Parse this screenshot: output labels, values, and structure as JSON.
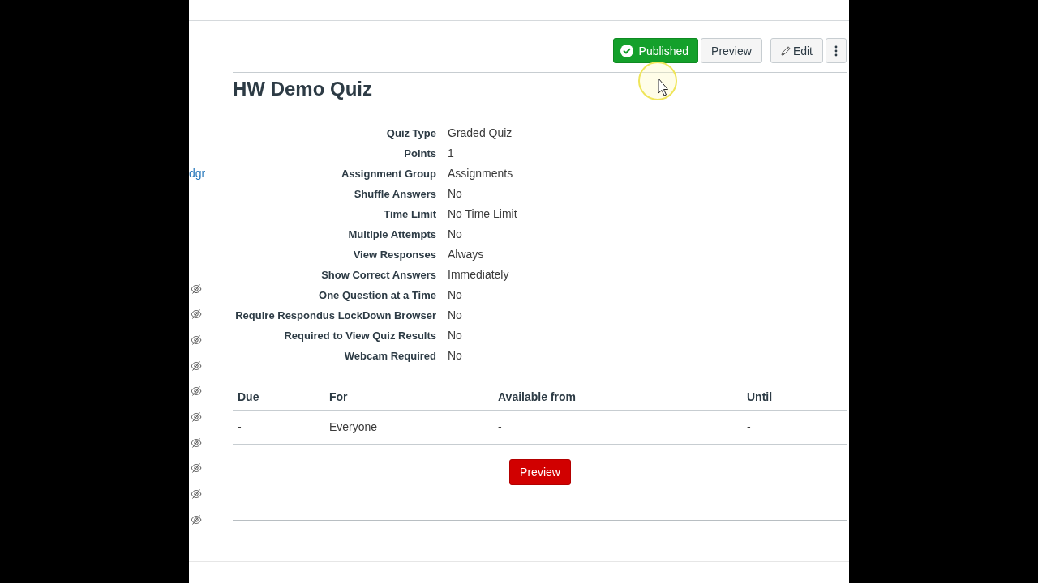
{
  "sidebar": {
    "link": "dgr",
    "rows": [
      {
        "hidden": true
      },
      {
        "hidden": true
      },
      {
        "hidden": true
      },
      {
        "hidden": true
      },
      {
        "hidden": true
      },
      {
        "hidden": true
      },
      {
        "hidden": true
      },
      {
        "hidden": true
      },
      {
        "hidden": true
      },
      {
        "hidden": true
      }
    ]
  },
  "actions": [
    {
      "kind": "published",
      "label": "Published"
    },
    {
      "kind": "preview",
      "label": "Preview"
    },
    {
      "kind": "edit",
      "label": "Edit"
    },
    {
      "kind": "menu"
    }
  ],
  "title": "HW Demo Quiz",
  "details": [
    {
      "label": "Quiz Type",
      "value": "Graded Quiz"
    },
    {
      "label": "Points",
      "value": "1"
    },
    {
      "label": "Assignment Group",
      "value": "Assignments"
    },
    {
      "label": "Shuffle Answers",
      "value": "No"
    },
    {
      "label": "Time Limit",
      "value": "No Time Limit"
    },
    {
      "label": "Multiple Attempts",
      "value": "No"
    },
    {
      "label": "View Responses",
      "value": "Always"
    },
    {
      "label": "Show Correct Answers",
      "value": "Immediately"
    },
    {
      "label": "One Question at a Time",
      "value": "No"
    },
    {
      "label": "Require Respondus LockDown Browser",
      "value": "No"
    },
    {
      "label": "Required to View Quiz Results",
      "value": "No"
    },
    {
      "label": "Webcam Required",
      "value": "No"
    }
  ],
  "dates_table": {
    "columns": [
      "Due",
      "For",
      "Available from",
      "Until"
    ],
    "rows": [
      [
        "-",
        "Everyone",
        "-",
        "-"
      ]
    ]
  },
  "preview_button": "Preview"
}
